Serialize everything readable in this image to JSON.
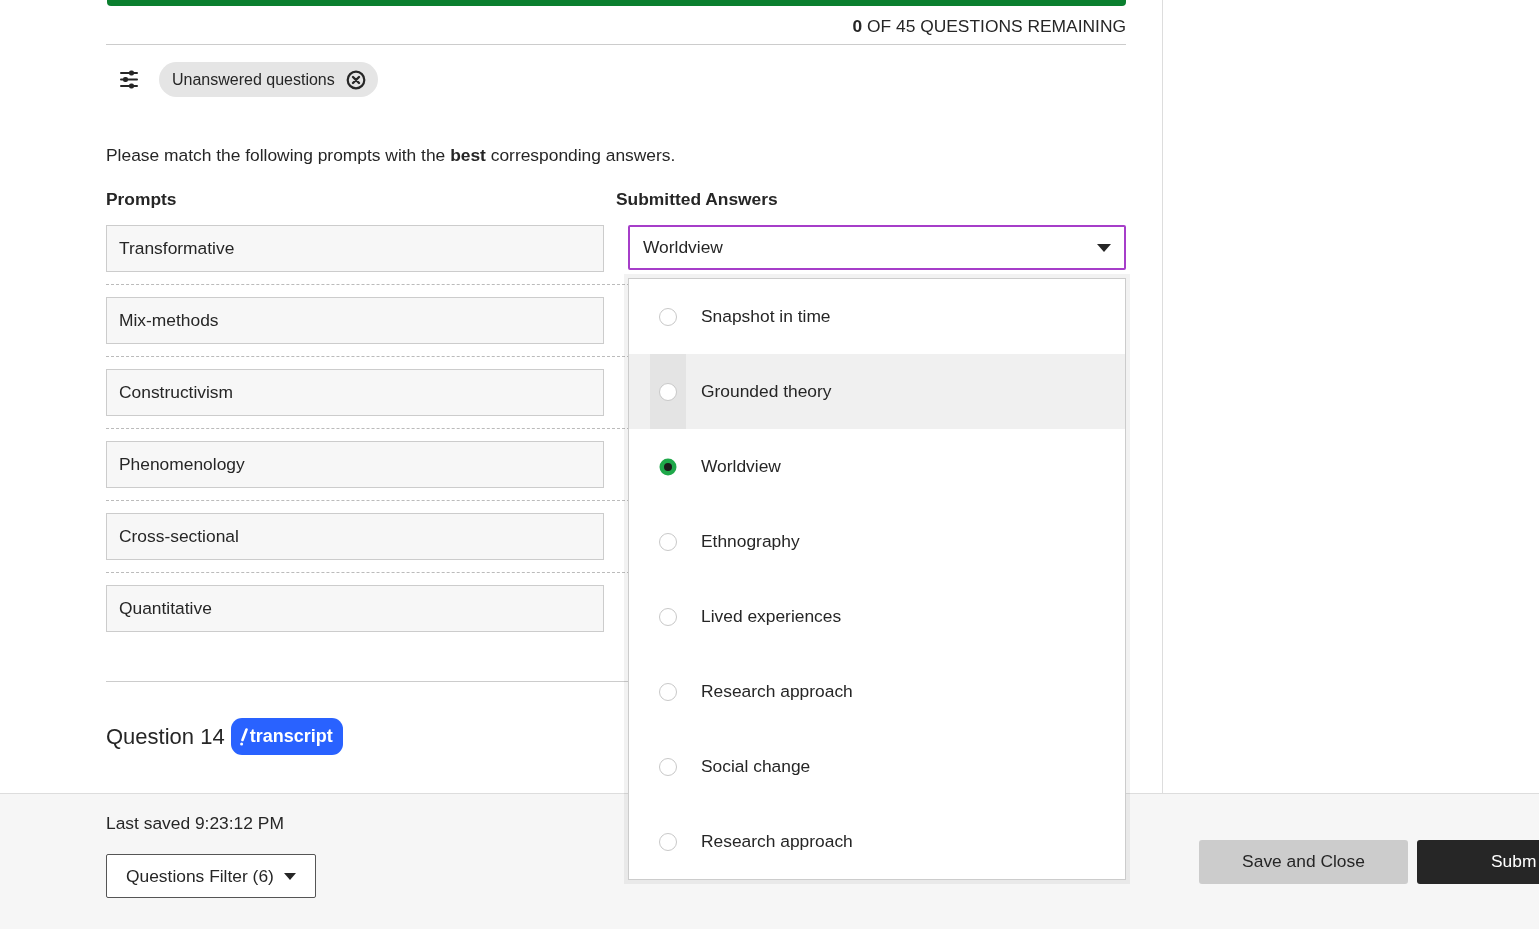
{
  "progress": {
    "level": 1,
    "remaining": "**0** OF 45 QUESTIONS REMAINING"
  },
  "filter": {
    "chips": [
      {
        "label": "Unanswered questions"
      }
    ]
  },
  "question": {
    "instruction": "Please match the following prompts with the **best** corresponding answers.",
    "prompts_heading": "Prompts",
    "answers_heading": "Submitted Answers",
    "rows": [
      {
        "prompt": "Transformative",
        "answer": {
          "value": "Worldview",
          "expanded": true,
          "options": [
            {
              "label": "Snapshot in time",
              "selected": false,
              "highlighted": false
            },
            {
              "label": "Grounded theory",
              "selected": false,
              "highlighted": true
            },
            {
              "label": "Worldview",
              "selected": true,
              "highlighted": false
            },
            {
              "label": "Ethnography",
              "selected": false,
              "highlighted": false
            },
            {
              "label": "Lived experiences",
              "selected": false,
              "highlighted": false
            },
            {
              "label": "Research approach",
              "selected": false,
              "highlighted": false
            },
            {
              "label": "Social change",
              "selected": false,
              "highlighted": false
            },
            {
              "label": "Research approach",
              "selected": false,
              "highlighted": false
            }
          ]
        }
      },
      {
        "prompt": "Mix-methods"
      },
      {
        "prompt": "Constructivism"
      },
      {
        "prompt": "Phenomenology"
      },
      {
        "prompt": "Cross-sectional"
      },
      {
        "prompt": "Quantitative"
      }
    ]
  },
  "next_question": {
    "title": "Question 14",
    "badge": "transcript"
  },
  "footer": {
    "last_saved": "Last saved 9:23:12 PM",
    "filter_button": "Questions Filter (6)",
    "buttons": [
      {
        "label": "Save and Close",
        "kind": "secondary"
      },
      {
        "label": "Subm",
        "kind": "primary"
      }
    ]
  }
}
